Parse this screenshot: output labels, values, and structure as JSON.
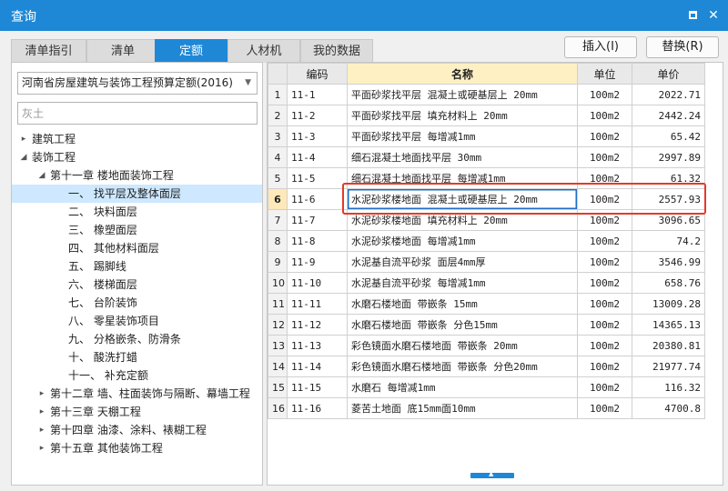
{
  "window": {
    "title": "查询"
  },
  "tabs": [
    {
      "label": "清单指引",
      "active": false
    },
    {
      "label": "清单",
      "active": false
    },
    {
      "label": "定额",
      "active": true
    },
    {
      "label": "人材机",
      "active": false
    },
    {
      "label": "我的数据",
      "active": false
    }
  ],
  "actions": {
    "insert": "插入(I)",
    "replace": "替换(R)"
  },
  "quota_library": {
    "selected": "河南省房屋建筑与装饰工程预算定额(2016)"
  },
  "search": {
    "value": "",
    "placeholder": "灰土"
  },
  "tree": [
    {
      "label": "建筑工程",
      "level": 0,
      "expander": "collapsed"
    },
    {
      "label": "装饰工程",
      "level": 0,
      "expander": "expanded"
    },
    {
      "label": "第十一章 楼地面装饰工程",
      "level": 1,
      "expander": "expanded"
    },
    {
      "label": "一、 找平层及整体面层",
      "level": 2,
      "expander": "none",
      "selected": true
    },
    {
      "label": "二、 块料面层",
      "level": 2,
      "expander": "none"
    },
    {
      "label": "三、 橡塑面层",
      "level": 2,
      "expander": "none"
    },
    {
      "label": "四、 其他材料面层",
      "level": 2,
      "expander": "none"
    },
    {
      "label": "五、 踢脚线",
      "level": 2,
      "expander": "none"
    },
    {
      "label": "六、 楼梯面层",
      "level": 2,
      "expander": "none"
    },
    {
      "label": "七、 台阶装饰",
      "level": 2,
      "expander": "none"
    },
    {
      "label": "八、 零星装饰项目",
      "level": 2,
      "expander": "none"
    },
    {
      "label": "九、 分格嵌条、防滑条",
      "level": 2,
      "expander": "none"
    },
    {
      "label": "十、 酸洗打蜡",
      "level": 2,
      "expander": "none"
    },
    {
      "label": "十一、 补充定额",
      "level": 2,
      "expander": "none"
    },
    {
      "label": "第十二章 墙、柱面装饰与隔断、幕墙工程",
      "level": 1,
      "expander": "collapsed"
    },
    {
      "label": "第十三章 天棚工程",
      "level": 1,
      "expander": "collapsed"
    },
    {
      "label": "第十四章 油漆、涂料、裱糊工程",
      "level": 1,
      "expander": "collapsed"
    },
    {
      "label": "第十五章 其他装饰工程",
      "level": 1,
      "expander": "collapsed"
    }
  ],
  "table": {
    "headers": {
      "code": "编码",
      "name": "名称",
      "unit": "单位",
      "price": "单价"
    },
    "current_row": 6,
    "rows": [
      {
        "num": "1",
        "code": "11-1",
        "name": "平面砂浆找平层 混凝土或硬基层上 20mm",
        "unit": "100m2",
        "price": "2022.71"
      },
      {
        "num": "2",
        "code": "11-2",
        "name": "平面砂浆找平层 填充材料上 20mm",
        "unit": "100m2",
        "price": "2442.24"
      },
      {
        "num": "3",
        "code": "11-3",
        "name": "平面砂浆找平层 每增减1mm",
        "unit": "100m2",
        "price": "65.42"
      },
      {
        "num": "4",
        "code": "11-4",
        "name": "细石混凝土地面找平层 30mm",
        "unit": "100m2",
        "price": "2997.89"
      },
      {
        "num": "5",
        "code": "11-5",
        "name": "细石混凝土地面找平层 每增减1mm",
        "unit": "100m2",
        "price": "61.32"
      },
      {
        "num": "6",
        "code": "11-6",
        "name": "水泥砂浆楼地面 混凝土或硬基层上 20mm",
        "unit": "100m2",
        "price": "2557.93"
      },
      {
        "num": "7",
        "code": "11-7",
        "name": "水泥砂浆楼地面 填充材料上 20mm",
        "unit": "100m2",
        "price": "3096.65"
      },
      {
        "num": "8",
        "code": "11-8",
        "name": "水泥砂浆楼地面 每增减1mm",
        "unit": "100m2",
        "price": "74.2"
      },
      {
        "num": "9",
        "code": "11-9",
        "name": "水泥基自流平砂浆 面层4mm厚",
        "unit": "100m2",
        "price": "3546.99"
      },
      {
        "num": "10",
        "code": "11-10",
        "name": "水泥基自流平砂浆 每增减1mm",
        "unit": "100m2",
        "price": "658.76"
      },
      {
        "num": "11",
        "code": "11-11",
        "name": "水磨石楼地面 带嵌条 15mm",
        "unit": "100m2",
        "price": "13009.28"
      },
      {
        "num": "12",
        "code": "11-12",
        "name": "水磨石楼地面 带嵌条 分色15mm",
        "unit": "100m2",
        "price": "14365.13"
      },
      {
        "num": "13",
        "code": "11-13",
        "name": "彩色镜面水磨石楼地面 带嵌条 20mm",
        "unit": "100m2",
        "price": "20380.81"
      },
      {
        "num": "14",
        "code": "11-14",
        "name": "彩色镜面水磨石楼地面 带嵌条 分色20mm",
        "unit": "100m2",
        "price": "21977.74"
      },
      {
        "num": "15",
        "code": "11-15",
        "name": "水磨石 每增减1mm",
        "unit": "100m2",
        "price": "116.32"
      },
      {
        "num": "16",
        "code": "11-16",
        "name": "菱苦土地面 底15mm面10mm",
        "unit": "100m2",
        "price": "4700.8"
      }
    ]
  },
  "colors": {
    "accent": "#1e88d6",
    "highlight_box": "#e23a2a",
    "name_header": "#fff0c4",
    "tree_selected": "#cde8ff"
  },
  "icons": {
    "maximize": "maximize-icon",
    "close": "close-icon",
    "dropdown": "chevron-down-icon",
    "expander_collapsed": "triangle-right-icon",
    "expander_expanded": "triangle-down-icon",
    "splitter": "chevron-up-icon"
  }
}
